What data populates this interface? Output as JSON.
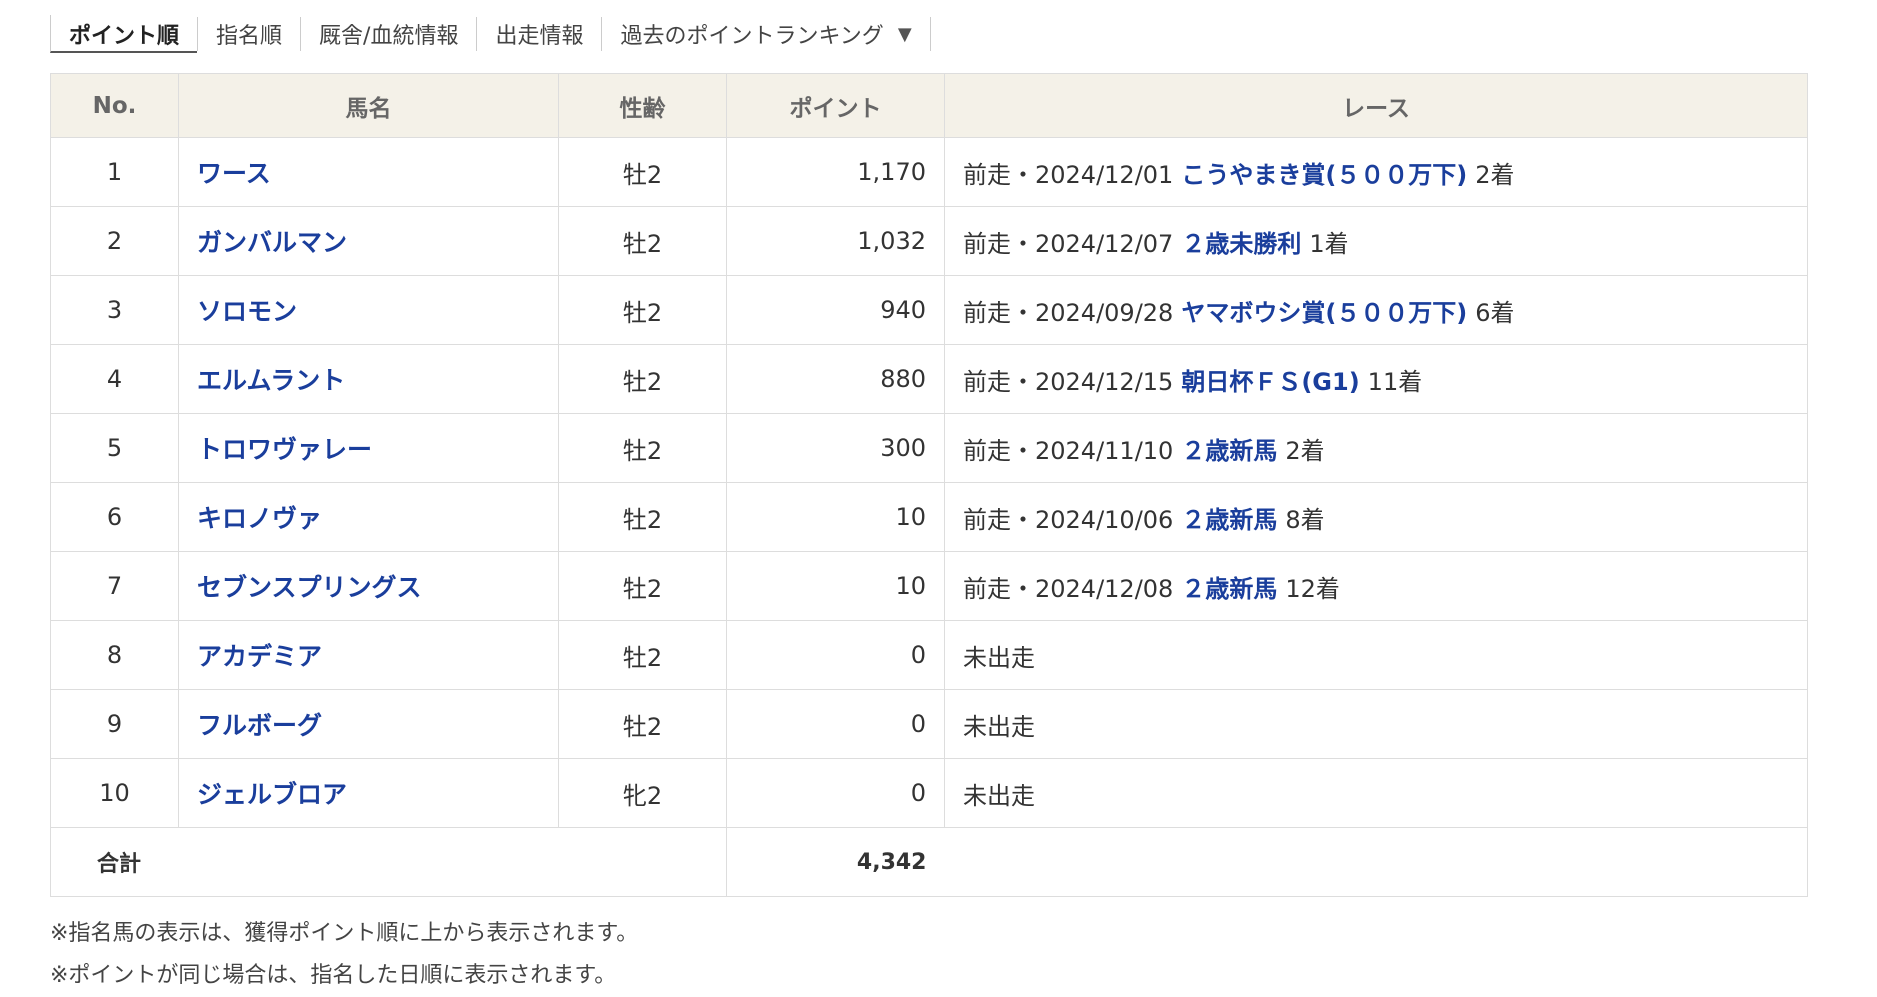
{
  "tabs": [
    {
      "label": "ポイント順",
      "active": true
    },
    {
      "label": "指名順",
      "active": false
    },
    {
      "label": "厩舎/血統情報",
      "active": false
    },
    {
      "label": "出走情報",
      "active": false
    },
    {
      "label": "過去のポイントランキング",
      "active": false,
      "caret": "▼"
    }
  ],
  "table": {
    "headers": [
      "No.",
      "馬名",
      "性齢",
      "ポイント",
      "レース"
    ],
    "rows": [
      {
        "no": "1",
        "name": "ワース",
        "sex_age": "牡2",
        "points": "1,170",
        "race_prefix": "前走・2024/12/01",
        "race_name": "こうやまき賞(５００万下)",
        "result": "2着"
      },
      {
        "no": "2",
        "name": "ガンバルマン",
        "sex_age": "牡2",
        "points": "1,032",
        "race_prefix": "前走・2024/12/07",
        "race_name": "２歳未勝利",
        "result": "1着"
      },
      {
        "no": "3",
        "name": "ソロモン",
        "sex_age": "牡2",
        "points": "940",
        "race_prefix": "前走・2024/09/28",
        "race_name": "ヤマボウシ賞(５００万下)",
        "result": "6着"
      },
      {
        "no": "4",
        "name": "エルムラント",
        "sex_age": "牡2",
        "points": "880",
        "race_prefix": "前走・2024/12/15",
        "race_name": "朝日杯ＦＳ(G1)",
        "result": "11着"
      },
      {
        "no": "5",
        "name": "トロワヴァレー",
        "sex_age": "牡2",
        "points": "300",
        "race_prefix": "前走・2024/11/10",
        "race_name": "２歳新馬",
        "result": "2着"
      },
      {
        "no": "6",
        "name": "キロノヴァ",
        "sex_age": "牡2",
        "points": "10",
        "race_prefix": "前走・2024/10/06",
        "race_name": "２歳新馬",
        "result": "8着"
      },
      {
        "no": "7",
        "name": "セブンスプリングス",
        "sex_age": "牡2",
        "points": "10",
        "race_prefix": "前走・2024/12/08",
        "race_name": "２歳新馬",
        "result": "12着"
      },
      {
        "no": "8",
        "name": "アカデミア",
        "sex_age": "牡2",
        "points": "0",
        "race_prefix": "未出走",
        "race_name": "",
        "result": ""
      },
      {
        "no": "9",
        "name": "フルボーグ",
        "sex_age": "牡2",
        "points": "0",
        "race_prefix": "未出走",
        "race_name": "",
        "result": ""
      },
      {
        "no": "10",
        "name": "ジェルブロア",
        "sex_age": "牝2",
        "points": "0",
        "race_prefix": "未出走",
        "race_name": "",
        "result": ""
      }
    ],
    "total_label": "合計",
    "total_points": "4,342"
  },
  "notes": [
    "※指名馬の表示は、獲得ポイント順に上から表示されます。",
    "※ポイントが同じ場合は、指名した日順に表示されます。"
  ]
}
